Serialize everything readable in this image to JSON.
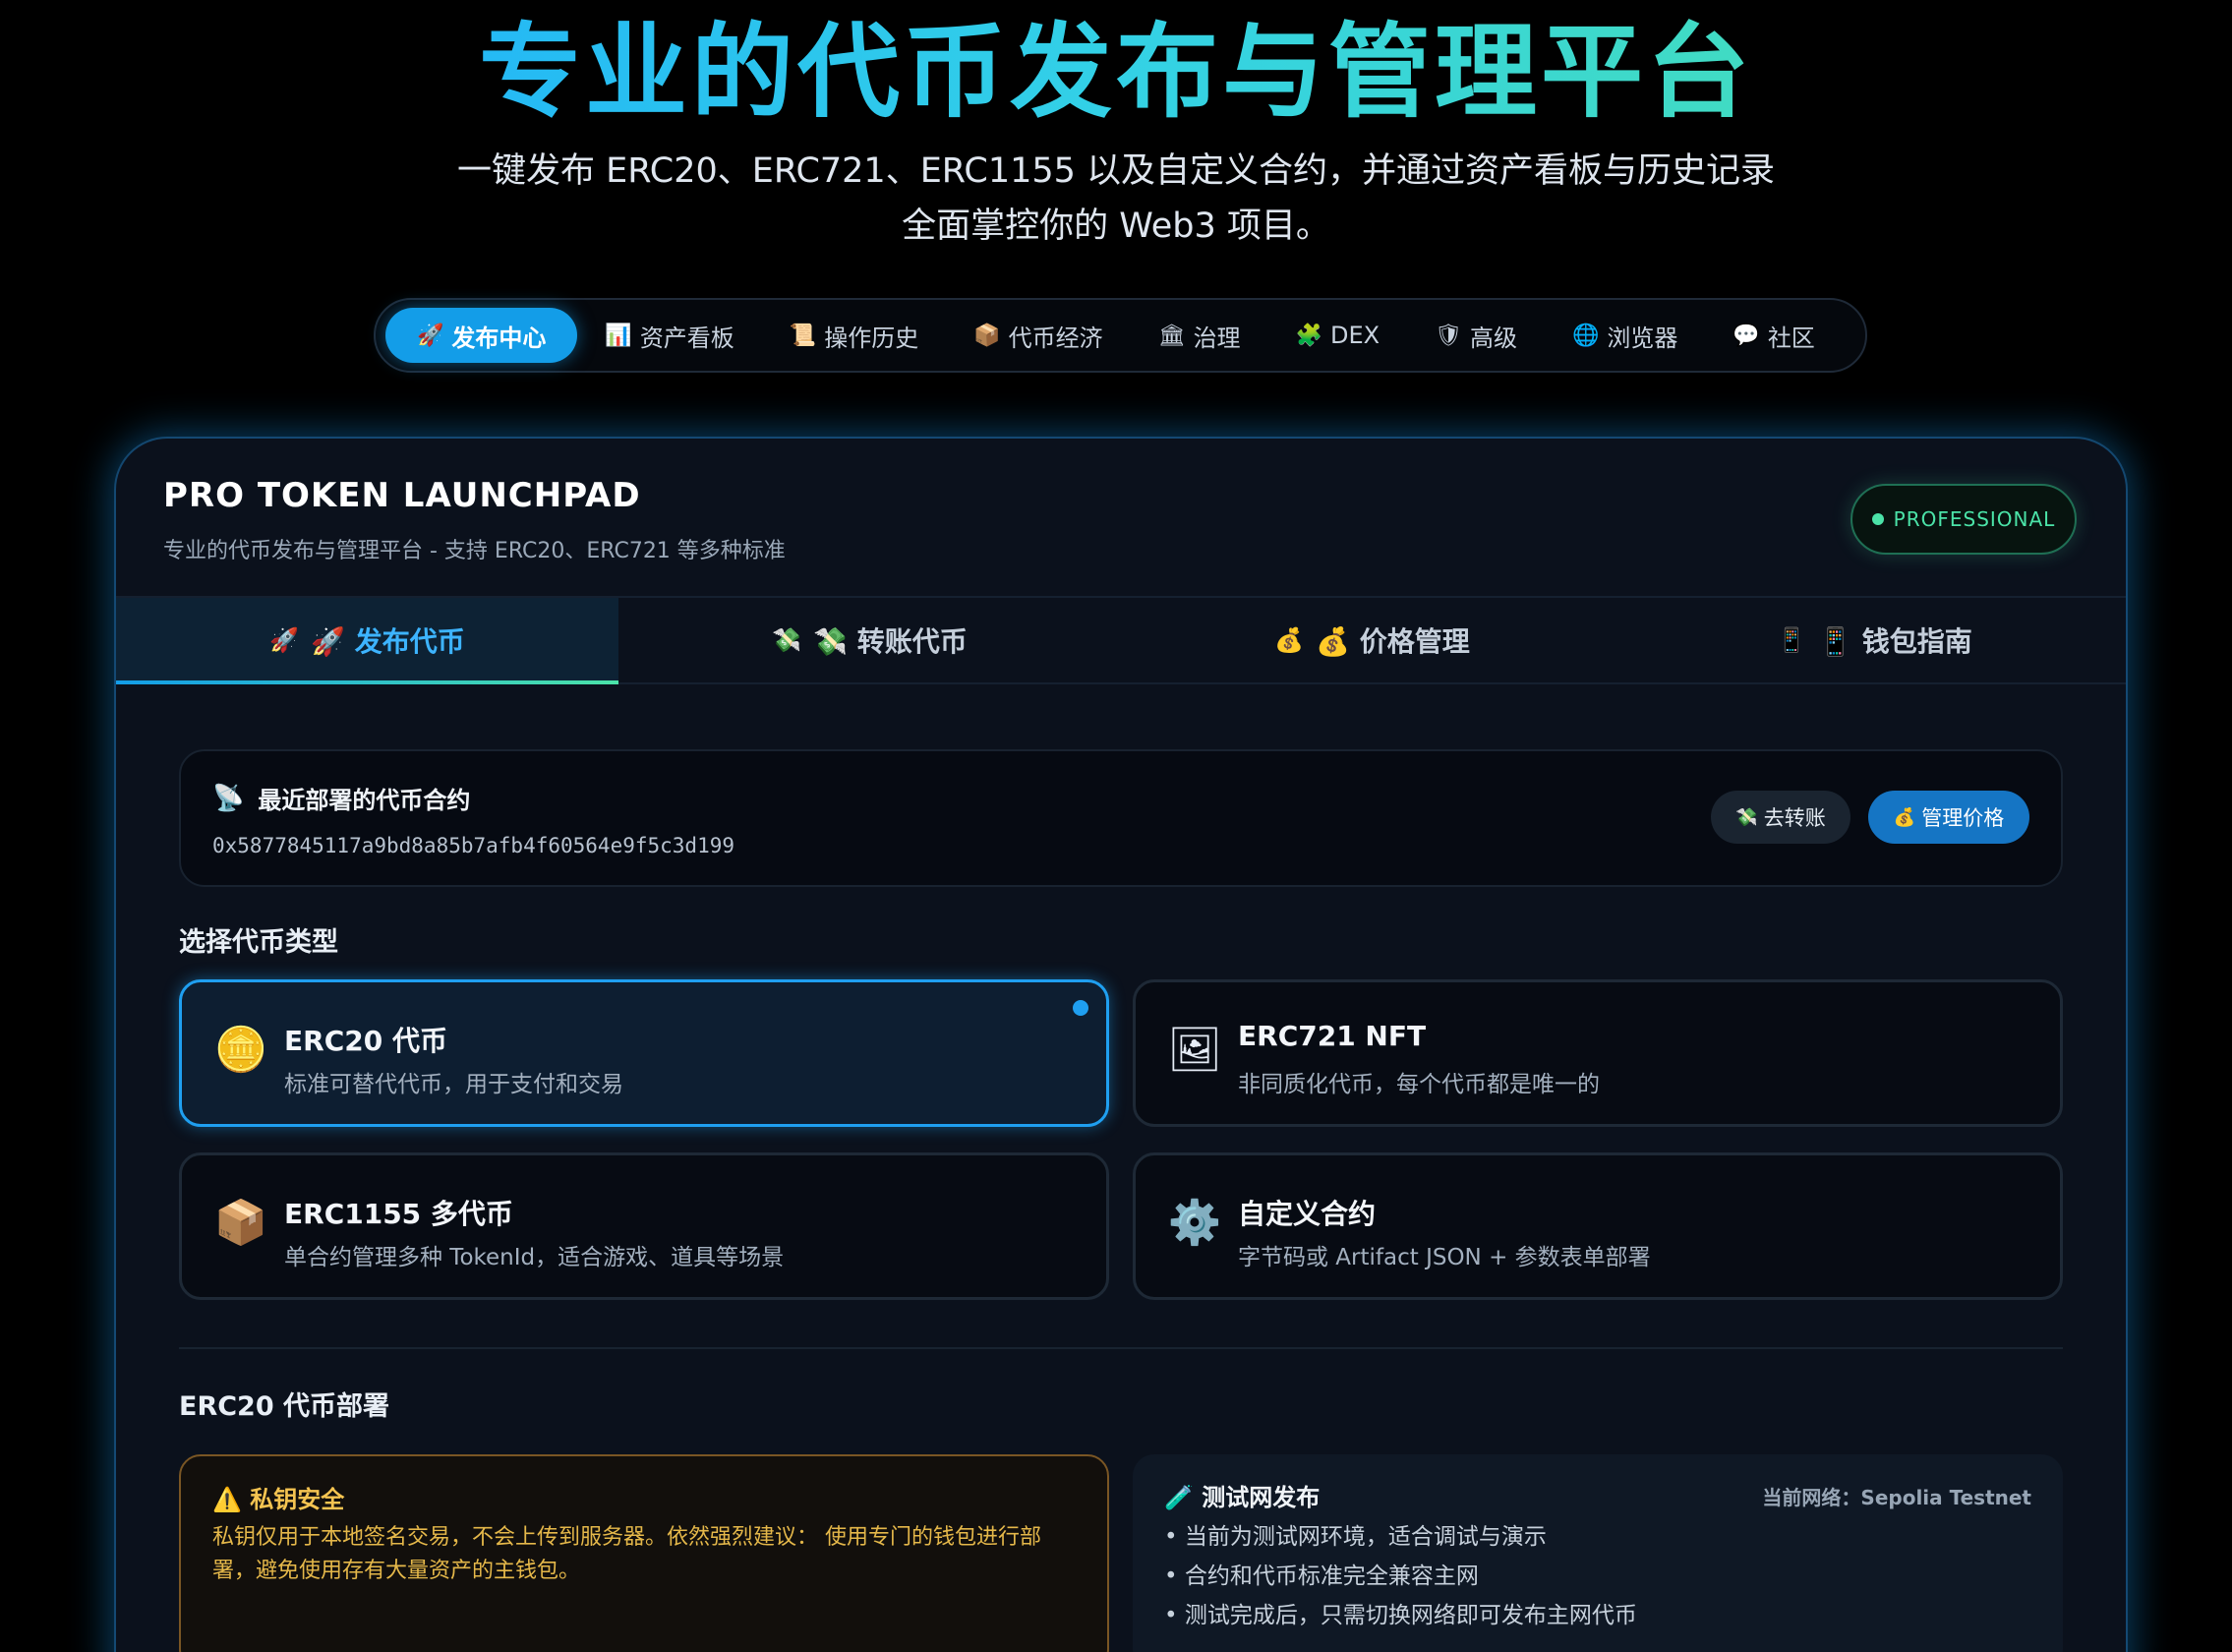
{
  "hero": {
    "title": "专业的代币发布与管理平台",
    "subtitle_line1": "一键发布 ERC20、ERC721、ERC1155 以及自定义合约，并通过资产看板与历史记录",
    "subtitle_line2": "全面掌控你的 Web3 项目。"
  },
  "nav": {
    "items": [
      {
        "icon": "🚀",
        "label": "发布中心"
      },
      {
        "icon": "📊",
        "label": "资产看板"
      },
      {
        "icon": "📜",
        "label": "操作历史"
      },
      {
        "icon": "📦",
        "label": "代币经济"
      },
      {
        "icon": "🏛",
        "label": "治理"
      },
      {
        "icon": "🧩",
        "label": "DEX"
      },
      {
        "icon": "🛡",
        "label": "高级"
      },
      {
        "icon": "🌐",
        "label": "浏览器"
      },
      {
        "icon": "💬",
        "label": "社区"
      }
    ]
  },
  "card": {
    "title": "PRO TOKEN LAUNCHPAD",
    "subtitle": "专业的代币发布与管理平台 - 支持 ERC20、ERC721 等多种标准",
    "badge": "PROFESSIONAL"
  },
  "tabs": [
    {
      "icon": "🚀",
      "label": "🚀 发布代币"
    },
    {
      "icon": "💸",
      "label": "💸 转账代币"
    },
    {
      "icon": "💰",
      "label": "💰 价格管理"
    },
    {
      "icon": "📱",
      "label": "📱 钱包指南"
    }
  ],
  "recent": {
    "icon": "📡",
    "title": "最近部署的代币合约",
    "address": "0x5877845117a9bd8a85b7afb4f60564e9f5c3d199",
    "transfer_icon": "💸",
    "transfer_label": "去转账",
    "price_icon": "💰",
    "price_label": "管理价格"
  },
  "type_section": {
    "label": "选择代币类型",
    "types": [
      {
        "icon": "🪙",
        "name": "ERC20 代币",
        "desc": "标准可替代代币，用于支付和交易"
      },
      {
        "icon": "🖼",
        "name": "ERC721 NFT",
        "desc": "非同质化代币，每个代币都是唯一的"
      },
      {
        "icon": "📦",
        "name": "ERC1155 多代币",
        "desc": "单合约管理多种 TokenId，适合游戏、道具等场景"
      },
      {
        "icon": "⚙️",
        "name": "自定义合约",
        "desc": "字节码或 Artifact JSON + 参数表单部署"
      }
    ]
  },
  "deploy": {
    "label": "ERC20 代币部署",
    "warning_title": "⚠️ 私钥安全",
    "warning_text": "私钥仅用于本地签名交易，不会上传到服务器。依然强烈建议： 使用专门的钱包进行部署，避免使用存有大量资产的主钱包。",
    "test_title": "🧪 测试网发布",
    "test_network": "当前网络：Sepolia Testnet",
    "test_points": [
      "当前为测试网环境，适合调试与演示",
      "合约和代币标准完全兼容主网",
      "测试完成后，只需切换网络即可发布主网代币"
    ]
  },
  "colors": {
    "accent": "#139de8",
    "success": "#4be3a8",
    "warning": "#f5c451"
  }
}
